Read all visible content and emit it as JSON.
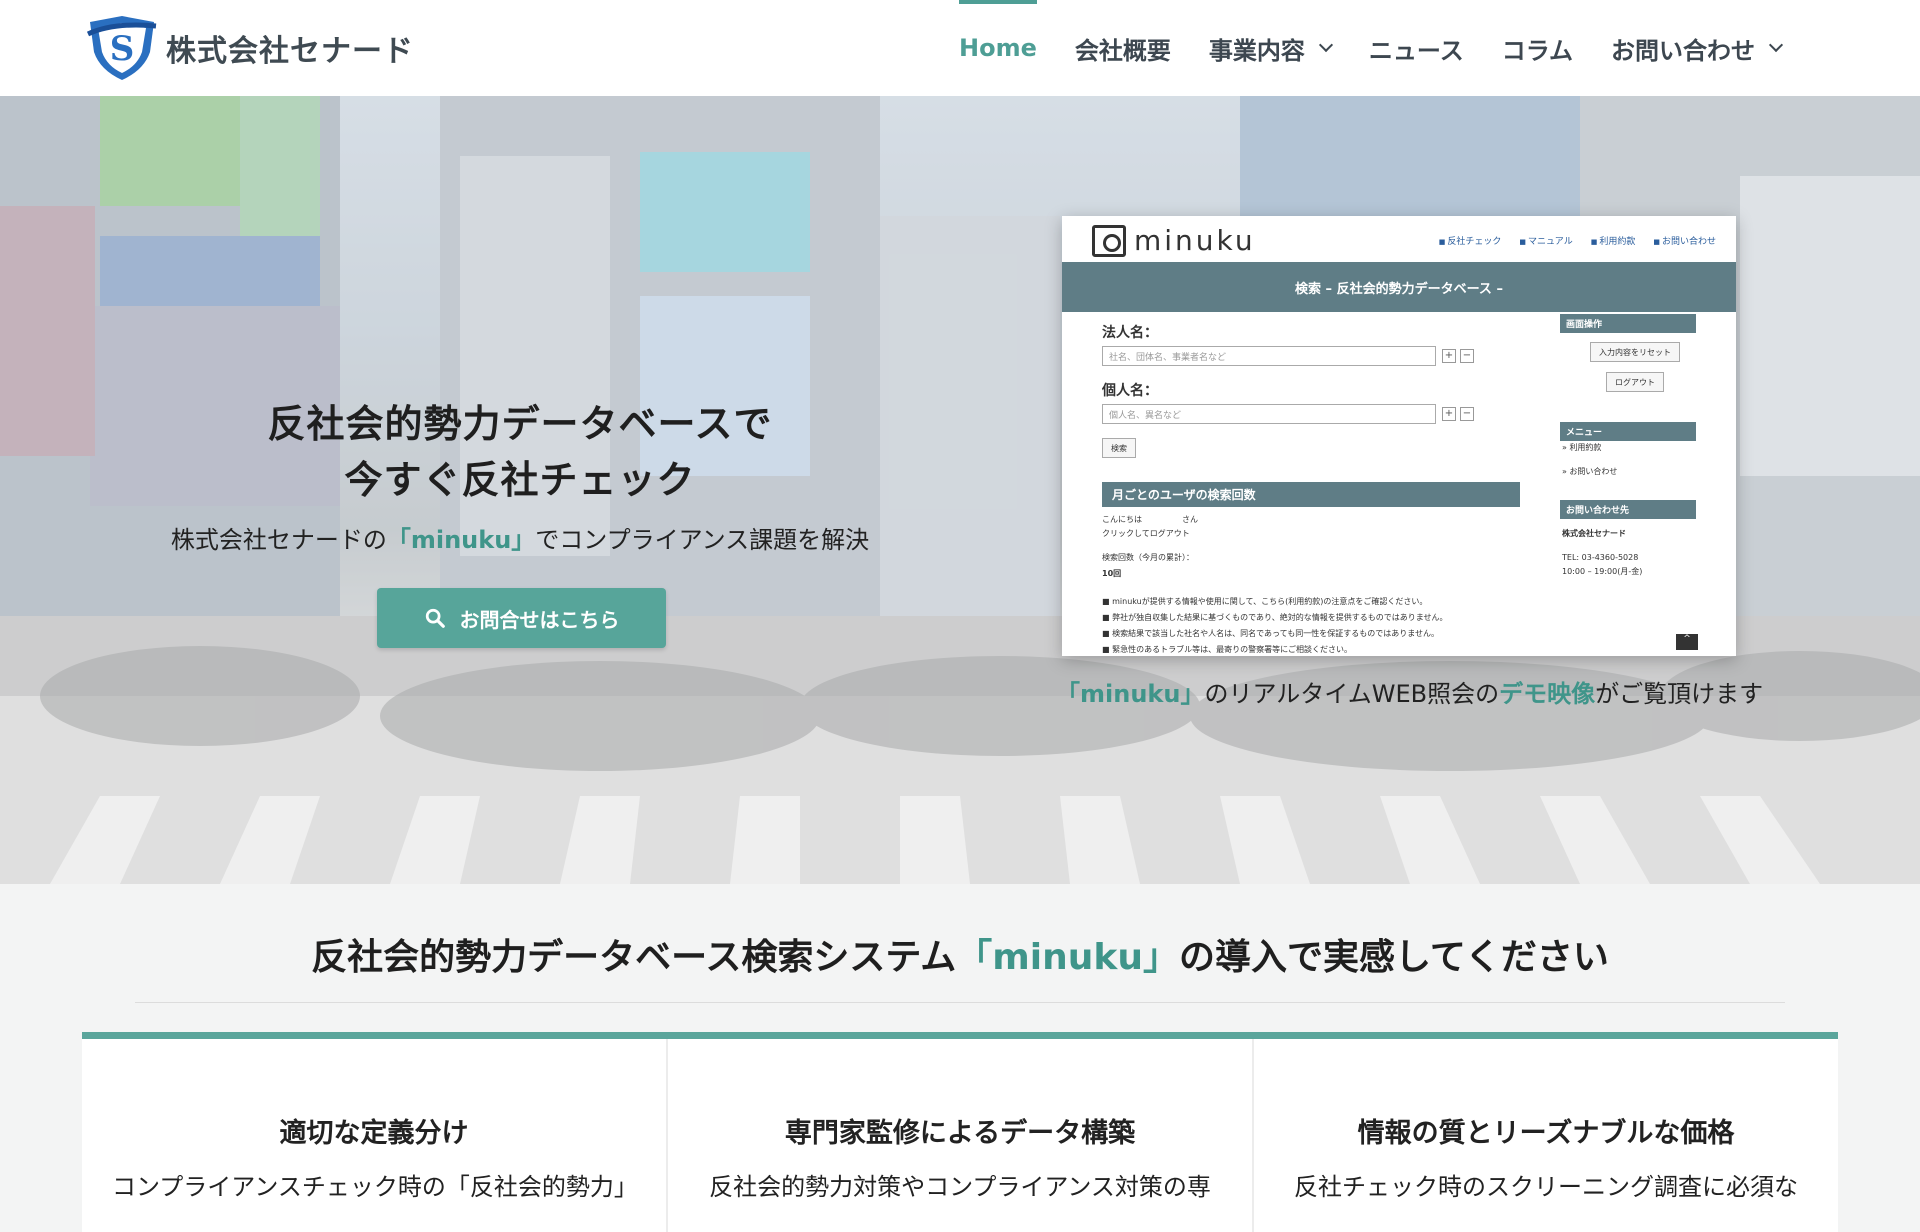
{
  "header": {
    "logo_text": "株式会社セナード",
    "nav": [
      {
        "label": "Home",
        "active": true,
        "has_dropdown": false
      },
      {
        "label": "会社概要",
        "active": false,
        "has_dropdown": false
      },
      {
        "label": "事業内容",
        "active": false,
        "has_dropdown": true
      },
      {
        "label": "ニュース",
        "active": false,
        "has_dropdown": false
      },
      {
        "label": "コラム",
        "active": false,
        "has_dropdown": false
      },
      {
        "label": "お問い合わせ",
        "active": false,
        "has_dropdown": true
      }
    ]
  },
  "hero": {
    "title_line1": "反社会的勢力データベースで",
    "title_line2": "今すぐ反社チェック",
    "subtitle_pre": "株式会社セナードの",
    "subtitle_accent": "「minuku」",
    "subtitle_post": "でコンプライアンス課題を解決",
    "cta_label": "お問合せはこちら",
    "screenshot": {
      "logo": "minuku",
      "menu": [
        "反社チェック",
        "マニュアル",
        "利用約款",
        "お問い合わせ"
      ],
      "bar_title": "検索 – 反社会的勢力データベース –",
      "corp_label": "法人名：",
      "corp_placeholder": "社名、団体名、事業者名など",
      "person_label": "個人名：",
      "person_placeholder": "個人名、異名など",
      "search_btn": "検索",
      "plus": "+",
      "minus": "−",
      "count_title": "月ごとのユーザの検索回数",
      "greeting": "こんにちは　　　　　さん",
      "logout_link": "クリックしてログアウト",
      "count_label": "検索回数（今月の累計）：",
      "count_value": "10回",
      "notes": [
        "■ minukuが提供する情報や使用に関して、こちら(利用約款)の注意点をご確認ください。",
        "■ 弊社が独自収集した結果に基づくものであり、絶対的な情報を提供するものではありません。",
        "■ 検索結果で該当した社名や人名は、同名であっても同一性を保証するものではありません。",
        "■ 緊急性のあるトラブル等は、最寄りの警察署等にご相談ください。"
      ],
      "side_ops": "画面操作",
      "side_reset": "入力内容をリセット",
      "side_logout": "ログアウト",
      "side_menu": "メニュー",
      "side_terms": "» 利用約款",
      "side_contact": "» お問い合わせ",
      "side_inquiry": "お問い合わせ先",
      "side_company": "株式会社セナード",
      "side_tel": "TEL: 03-4360-5028",
      "side_hours": "10:00 – 19:00(月-金)",
      "scroll_top": "^"
    },
    "caption_accent1": "「minuku」",
    "caption_mid": "のリアルタイムWEB照会の",
    "caption_accent2": "デモ映像",
    "caption_post": "がご覧頂けます"
  },
  "features": {
    "title_pre": "反社会的勢力データベース検索システム",
    "title_accent": "「minuku」",
    "title_post": "の導入で実感してください",
    "cards": [
      {
        "title": "適切な定義分け",
        "text": "コンプライアンスチェック時の「反社会的勢力」"
      },
      {
        "title": "専門家監修によるデータ構築",
        "text": "反社会的勢力対策やコンプライアンス対策の専"
      },
      {
        "title": "情報の質とリーズナブルな価格",
        "text": "反社チェック時のスクリーニング調査に必須な"
      }
    ]
  },
  "colors": {
    "accent": "#4e9e95",
    "button": "#57a59a",
    "bar": "#5f7d86"
  }
}
